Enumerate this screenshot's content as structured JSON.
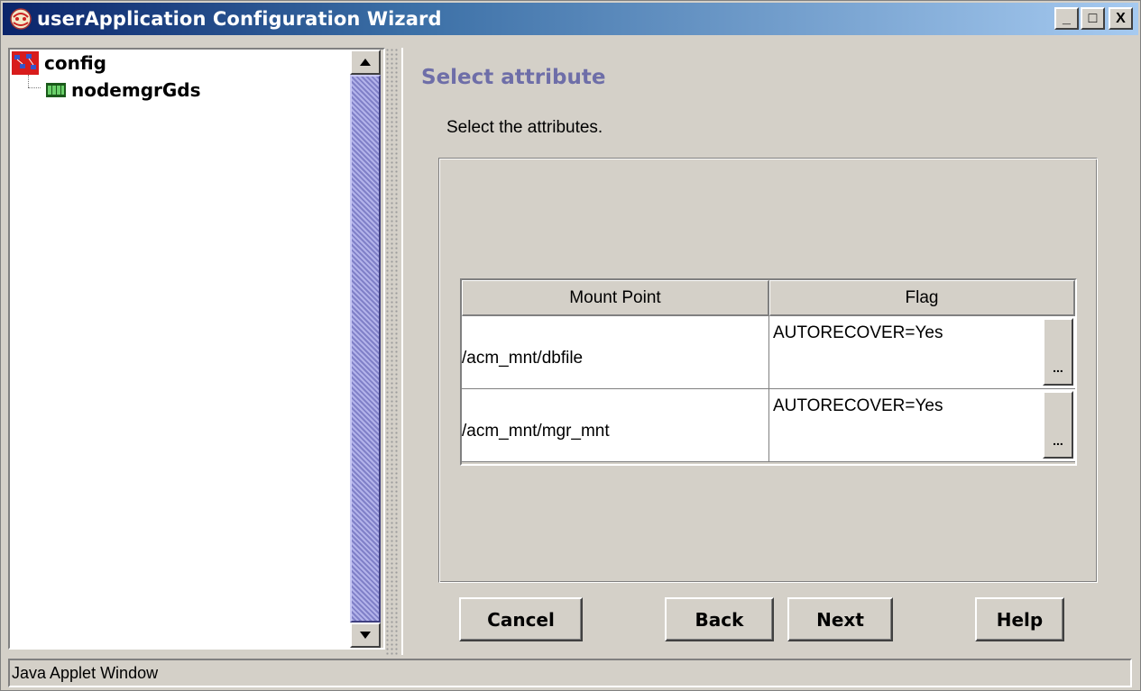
{
  "window": {
    "title": "userApplication Configuration Wizard",
    "controls": {
      "minimize": "_",
      "maximize": "□",
      "close": "X"
    }
  },
  "tree": {
    "root": {
      "label": "config",
      "icon": "config-icon"
    },
    "children": [
      {
        "label": "nodemgrGds",
        "icon": "resource-icon"
      }
    ]
  },
  "page": {
    "title": "Select attribute",
    "instruction": "Select the attributes."
  },
  "table": {
    "columns": [
      "Mount Point",
      "Flag"
    ],
    "rows": [
      {
        "mount_point": "/acm_mnt/dbfile",
        "flag": "AUTORECOVER=Yes",
        "button": "..."
      },
      {
        "mount_point": "/acm_mnt/mgr_mnt",
        "flag": "AUTORECOVER=Yes",
        "button": "..."
      }
    ]
  },
  "buttons": {
    "cancel": "Cancel",
    "back": "Back",
    "next": "Next",
    "help": "Help"
  },
  "status": {
    "text": "Java Applet Window"
  },
  "colors": {
    "title_gradient_start": "#0a246a",
    "title_gradient_end": "#a6caf0",
    "page_title": "#6e6ea8",
    "scroll_thumb": "#9494d6",
    "background": "#d4d0c8"
  }
}
